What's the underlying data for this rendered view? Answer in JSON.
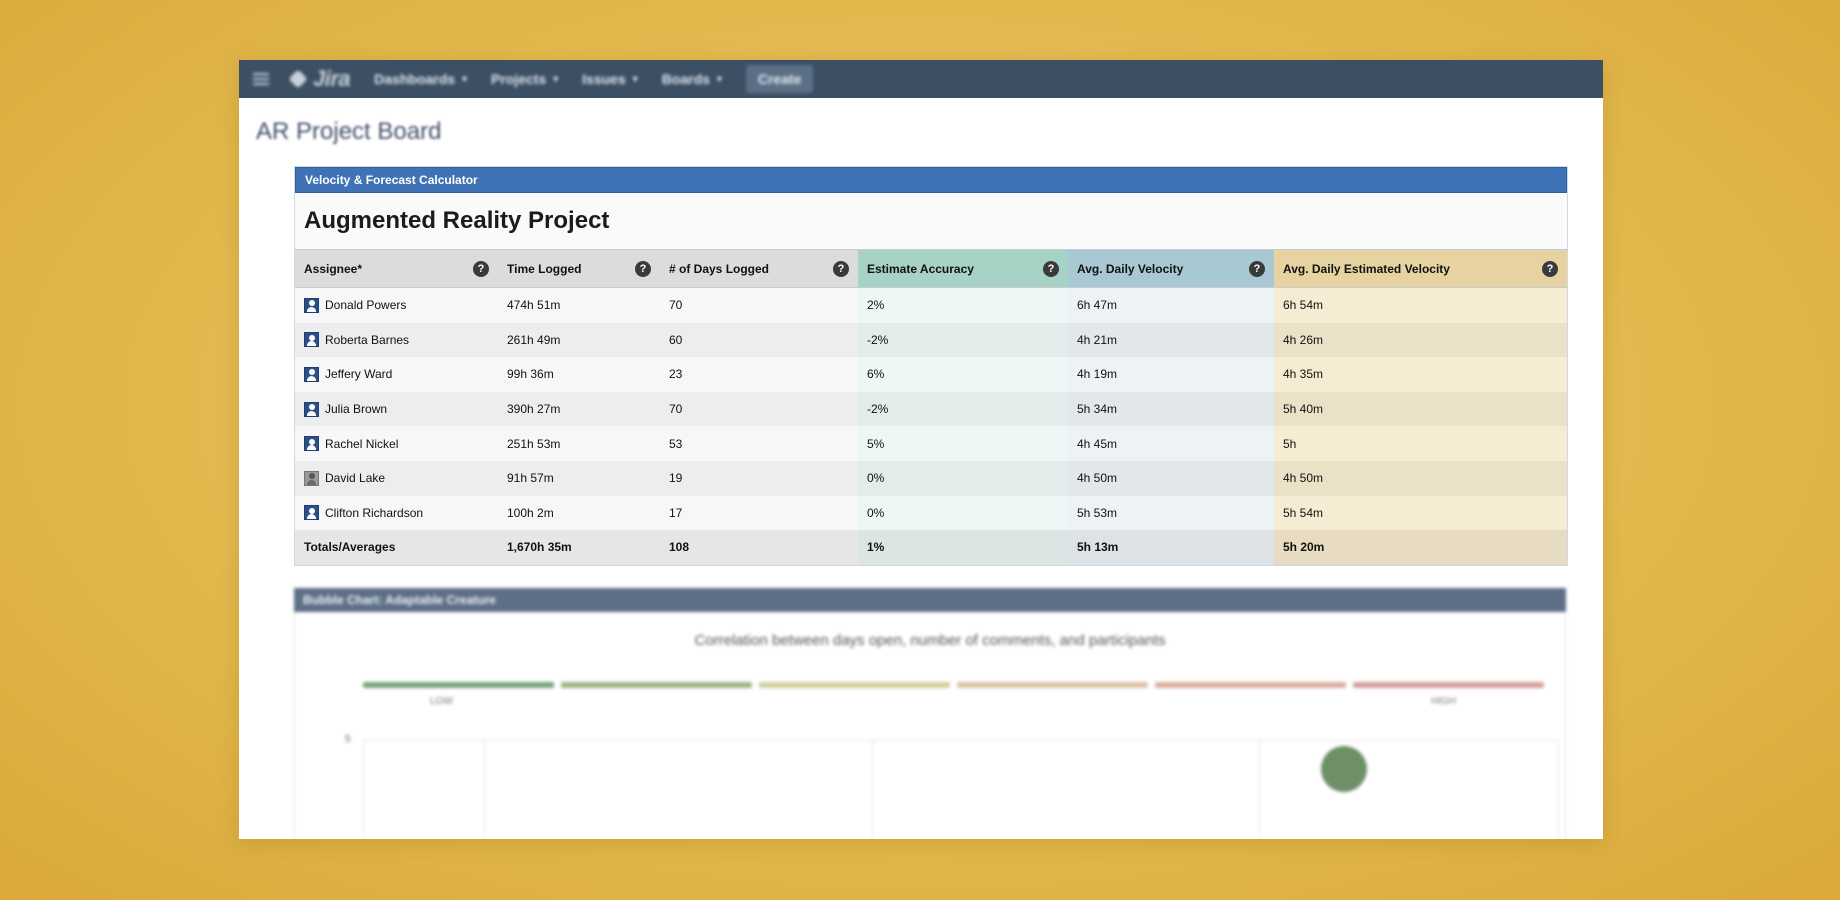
{
  "nav": {
    "logo": "Jira",
    "items": [
      "Dashboards",
      "Projects",
      "Issues",
      "Boards"
    ],
    "create_label": "Create"
  },
  "page": {
    "title": "AR Project Board"
  },
  "gadget": {
    "header": "Velocity & Forecast Calculator",
    "title": "Augmented Reality Project",
    "columns": [
      "Assignee*",
      "Time Logged",
      "# of Days Logged",
      "Estimate Accuracy",
      "Avg. Daily Velocity",
      "Avg. Daily Estimated Velocity"
    ],
    "rows": [
      {
        "assignee": "Donald Powers",
        "time_logged": "474h 51m",
        "days_logged": "70",
        "accuracy": "2%",
        "daily_velocity": "6h 47m",
        "est_velocity": "6h 54m"
      },
      {
        "assignee": "Roberta Barnes",
        "time_logged": "261h 49m",
        "days_logged": "60",
        "accuracy": "-2%",
        "daily_velocity": "4h 21m",
        "est_velocity": "4h 26m"
      },
      {
        "assignee": "Jeffery Ward",
        "time_logged": "99h 36m",
        "days_logged": "23",
        "accuracy": "6%",
        "daily_velocity": "4h 19m",
        "est_velocity": "4h 35m"
      },
      {
        "assignee": "Julia Brown",
        "time_logged": "390h 27m",
        "days_logged": "70",
        "accuracy": "-2%",
        "daily_velocity": "5h 34m",
        "est_velocity": "5h 40m"
      },
      {
        "assignee": "Rachel Nickel",
        "time_logged": "251h 53m",
        "days_logged": "53",
        "accuracy": "5%",
        "daily_velocity": "4h 45m",
        "est_velocity": "5h"
      },
      {
        "assignee": "David Lake",
        "time_logged": "91h 57m",
        "days_logged": "19",
        "accuracy": "0%",
        "daily_velocity": "4h 50m",
        "est_velocity": "4h 50m"
      },
      {
        "assignee": "Clifton Richardson",
        "time_logged": "100h 2m",
        "days_logged": "17",
        "accuracy": "0%",
        "daily_velocity": "5h 53m",
        "est_velocity": "5h 54m"
      }
    ],
    "totals": {
      "label": "Totals/Averages",
      "time_logged": "1,670h 35m",
      "days_logged": "108",
      "accuracy": "1%",
      "daily_velocity": "5h 13m",
      "est_velocity": "5h 20m"
    },
    "help_glyph": "?"
  },
  "bubble_gadget": {
    "header": "Bubble Chart: Adaptable Creature",
    "subtitle": "Correlation between days open, number of comments, and participants",
    "legend_low": "LOW",
    "legend_high": "HIGH",
    "legend_colors": [
      "#7aa37a",
      "#9bb783",
      "#d3cfa0",
      "#ddc3a6",
      "#dcb0a0",
      "#d7a0a0"
    ],
    "y_tick_top": "5",
    "bubble_color": "#6f8f68"
  }
}
